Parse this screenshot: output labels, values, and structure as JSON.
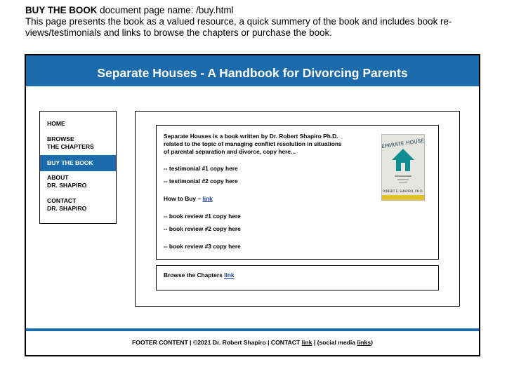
{
  "header": {
    "title_bold": "BUY THE BOOK",
    "title_rest": " document page name: /buy.html",
    "desc_line1": "This page presents the book as a valued resource, a quick summery of the book and includes book re-",
    "desc_line2": "views/testimonials and links to browse the chapters or purchase the book."
  },
  "site": {
    "banner_title": "Separate Houses - A Handbook for Divorcing Parents"
  },
  "nav": {
    "home": "HOME",
    "browse_1": "BROWSE",
    "browse_2": "THE CHAPTERS",
    "buy": "BUY THE BOOK",
    "about_1": "ABOUT",
    "about_2": "DR. SHAPIRO",
    "contact_1": "CONTACT",
    "contact_2": "DR. SHAPIRO"
  },
  "content": {
    "intro_1": "Separate Houses is a book written by Dr. Robert Shapiro Ph.D.",
    "intro_2": "related to the topic of managing conflict resolution in situations",
    "intro_3": "of parental separation and divorce, copy here...",
    "testimonial_1": "-- testimonial #1 copy here",
    "testimonial_2": "-- testimonial #2 copy here",
    "how_to_buy": "How to Buy – ",
    "how_to_buy_link": "link",
    "review_1": "-- book review #1 copy here",
    "review_2": "-- book review #2 copy here",
    "review_3": "-- book review #3 copy here",
    "browse_text": "Browse the Chapters ",
    "browse_link": "link"
  },
  "cover": {
    "title": "SEPARATE HOUSES",
    "author": "ROBERT E. SHAPIRO, PH.D."
  },
  "footer": {
    "text_1": "FOOTER CONTENT  |  ©2021 Dr. Robert Shapiro  |  CONTACT ",
    "contact_link": "link",
    "text_2": "  |     (social media ",
    "social_link": "links",
    "text_3": ")"
  }
}
